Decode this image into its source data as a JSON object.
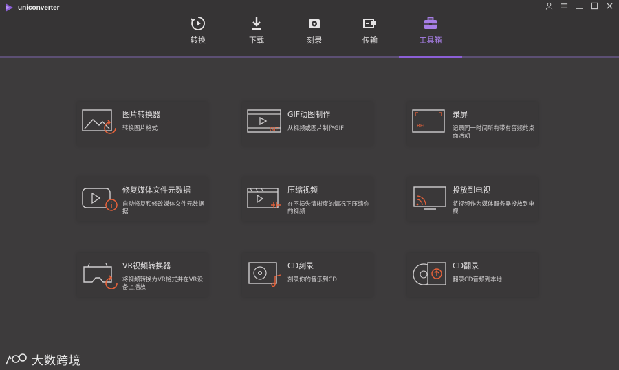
{
  "app": {
    "name": "uniconverter"
  },
  "window_controls": [
    "user-icon",
    "menu-icon",
    "minimize-icon",
    "maximize-icon",
    "close-icon"
  ],
  "nav": {
    "items": [
      {
        "label": "转换",
        "icon": "convert-icon"
      },
      {
        "label": "下载",
        "icon": "download-icon"
      },
      {
        "label": "刻录",
        "icon": "burn-icon"
      },
      {
        "label": "传输",
        "icon": "transfer-icon"
      },
      {
        "label": "工具箱",
        "icon": "toolbox-icon",
        "active": true
      }
    ],
    "active_color": "#a77ee6"
  },
  "tools": [
    {
      "title": "图片转换器",
      "desc": "转换图片格式",
      "icon": "image-convert-icon"
    },
    {
      "title": "GIF动图制作",
      "desc": "从视频或图片制作GIF",
      "icon": "gif-maker-icon"
    },
    {
      "title": "录屏",
      "desc": "记录同一时间所有带有音频的桌面活动",
      "icon": "screen-record-icon"
    },
    {
      "title": "修复媒体文件元数据",
      "desc": "自动修复和修改媒体文件元数据据",
      "icon": "metadata-fix-icon"
    },
    {
      "title": "压缩视频",
      "desc": "在不损失清晰度的情况下压缩你的视频",
      "icon": "compress-video-icon"
    },
    {
      "title": "投放到电视",
      "desc": "将视频作为媒体服务器投放到电视",
      "icon": "cast-tv-icon"
    },
    {
      "title": "VR视频转换器",
      "desc": "将视频转换为VR格式并在VR设备上播放",
      "icon": "vr-convert-icon"
    },
    {
      "title": "CD刻录",
      "desc": "刻录你的音乐到CD",
      "icon": "cd-burn-icon"
    },
    {
      "title": "CD翻录",
      "desc": "翻录CD音频到本地",
      "icon": "cd-rip-icon"
    }
  ],
  "accent_colors": {
    "orange": "#e8623a",
    "purple": "#8b5fd6"
  },
  "watermark": {
    "text": "大数跨境"
  }
}
